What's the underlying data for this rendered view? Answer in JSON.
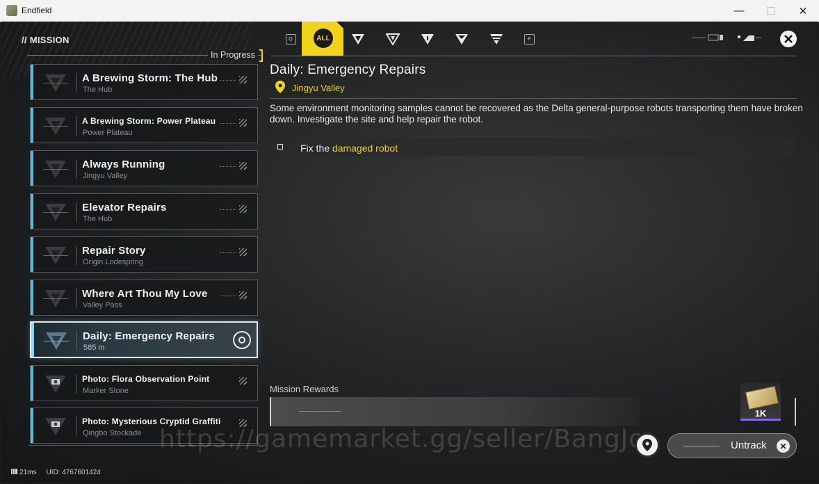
{
  "window": {
    "title": "Endfield",
    "minimize": "—",
    "maximize": "☐",
    "close": "✕"
  },
  "header": {
    "section": "// MISSION",
    "in_progress": "In Progress"
  },
  "filters": {
    "all_label": "ALL",
    "left_key": "Q",
    "right_key": "E",
    "items": [
      "main-story-filter",
      "side-story-filter",
      "exploration-filter",
      "event-filter",
      "commission-filter"
    ]
  },
  "missions": [
    {
      "name": "A Brewing Storm: The Hub",
      "location": "The Hub",
      "selected": false
    },
    {
      "name": "A Brewing Storm: Power Plateau",
      "location": "Power Plateau",
      "selected": false
    },
    {
      "name": "Always Running",
      "location": "Jingyu Valley",
      "selected": false
    },
    {
      "name": "Elevator Repairs",
      "location": "The Hub",
      "selected": false
    },
    {
      "name": "Repair Story",
      "location": "Origin Lodespring",
      "selected": false
    },
    {
      "name": "Where Art Thou My Love",
      "location": "Valley Pass",
      "selected": false
    },
    {
      "name": "Daily: Emergency Repairs",
      "location": "585 m",
      "selected": true
    },
    {
      "name": "Photo: Flora Observation Point",
      "location": "Marker Stone",
      "selected": false
    },
    {
      "name": "Photo: Mysterious Cryptid Graffiti",
      "location": "Qingbo Stockade",
      "selected": false
    }
  ],
  "detail": {
    "title": "Daily: Emergency Repairs",
    "region": "Jingyu Valley",
    "description": "Some environment monitoring samples cannot be recovered as the Delta general-purpose robots transporting them have broken down. Investigate the site and help repair the robot.",
    "objective_prefix": "Fix the ",
    "objective_highlight": "damaged robot",
    "rewards_label": "Mission Rewards",
    "reward_qty": "1K"
  },
  "actions": {
    "untrack": "Untrack"
  },
  "watermark": "https://gamemarket.gg/seller/BangJo",
  "status": {
    "ping": "21ms",
    "uid": "UID: 4767601424"
  },
  "colors": {
    "accent_yellow": "#f2d21a",
    "accent_blue": "#5fb8dc",
    "reward_purple": "#8e62e6"
  }
}
